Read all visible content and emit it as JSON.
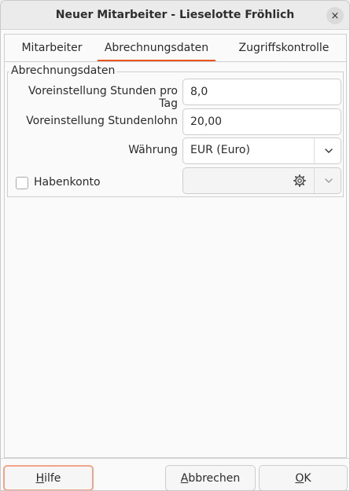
{
  "window": {
    "title": "Neuer Mitarbeiter - Lieselotte Fröhlich",
    "close_glyph": "×"
  },
  "tabs": [
    {
      "label": "Mitarbeiter",
      "active": false
    },
    {
      "label": "Abrechnungsdaten",
      "active": true
    },
    {
      "label": "Zugriffskontrolle",
      "active": false
    }
  ],
  "frame": {
    "label": "Abrechnungsdaten",
    "fields": {
      "hours_label": "Voreinstellung Stunden pro Tag",
      "hours_value": "8,0",
      "wage_label": "Voreinstellung Stundenlohn",
      "wage_value": "20,00",
      "currency_label": "Währung",
      "currency_value": "EUR (Euro)",
      "credit_label": "Habenkonto",
      "credit_checked": false,
      "credit_value": ""
    }
  },
  "buttons": {
    "help": {
      "accel": "H",
      "rest": "ilfe"
    },
    "cancel": {
      "accel": "A",
      "rest": "bbrechen"
    },
    "ok": {
      "accel": "O",
      "rest": "K"
    }
  },
  "colors": {
    "accent": "#e95420",
    "focus_border": "#f0a58a",
    "titlebar": "#ebebeb",
    "background": "#fafafa"
  },
  "icons": {
    "close": "close-icon",
    "dropdown": "chevron-down-icon",
    "account_picker": "gear-icon"
  }
}
